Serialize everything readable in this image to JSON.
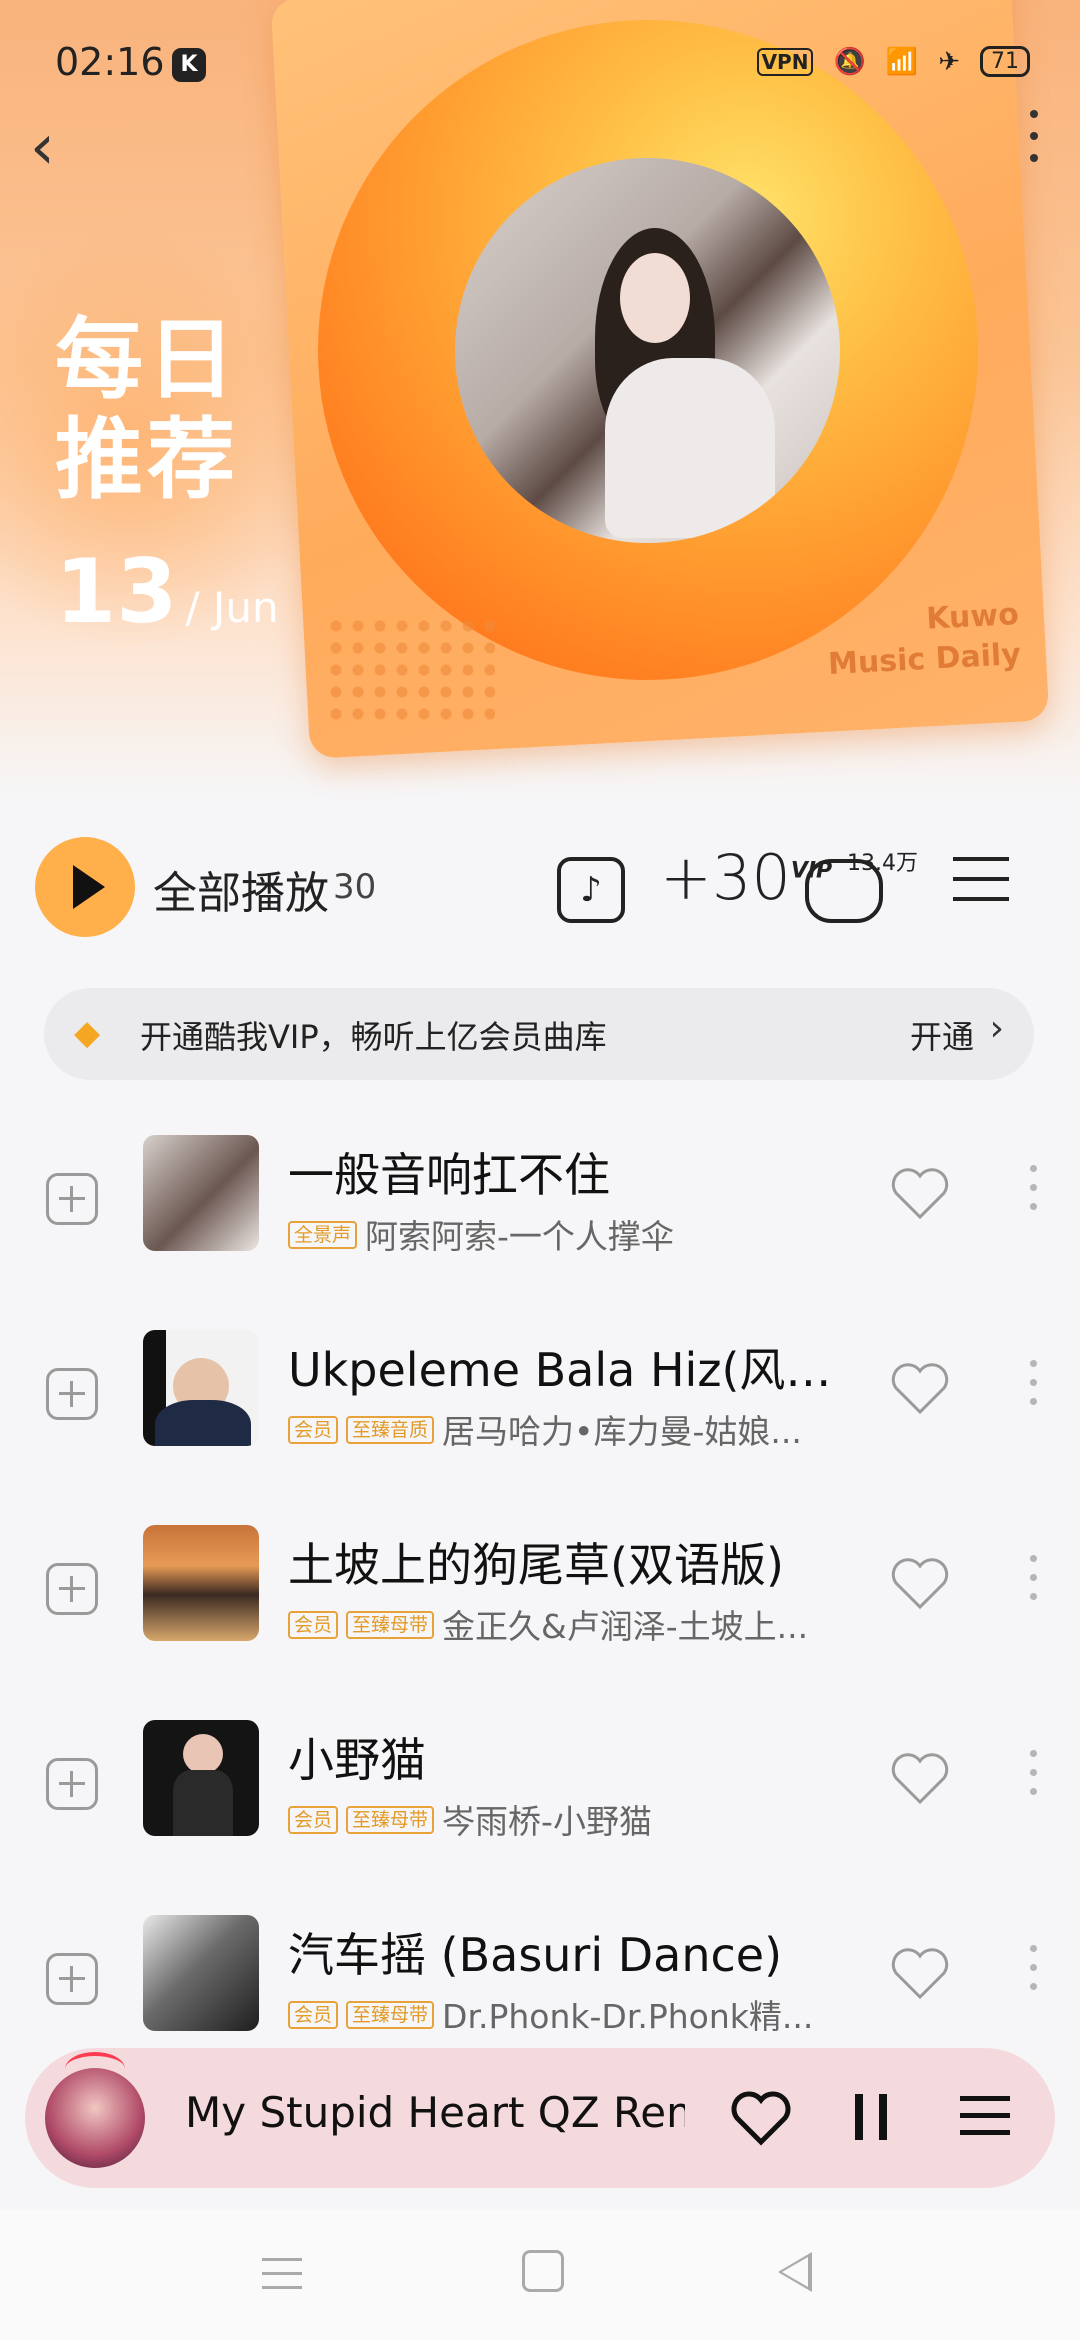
{
  "status_bar": {
    "time": "02:16",
    "app_icon": "K",
    "vpn": "VPN",
    "battery": "71"
  },
  "header": {
    "title_line1": "每日",
    "title_line2": "推荐",
    "day": "13",
    "month": "/ Jun",
    "brand_line1": "Kuwo",
    "brand_line2": "Music Daily"
  },
  "toolbar": {
    "play_all": "全部播放",
    "count": "30",
    "plus30": "+30",
    "vip_sup": "VIP",
    "comment_count": "13.4万"
  },
  "vip_banner": {
    "text": "开通酷我VIP，畅听上亿会员曲库",
    "action": "开通"
  },
  "songs": [
    {
      "title": "一般音响扛不住",
      "tags": [
        "全景声"
      ],
      "subtitle": "阿索阿索-一个人撑伞"
    },
    {
      "title": "Ukpeleme Bala Hiz(风情...",
      "tags": [
        "会员",
        "至臻音质"
      ],
      "subtitle": "居马哈力•库力曼-姑娘..."
    },
    {
      "title": "土坡上的狗尾草(双语版)",
      "tags": [
        "会员",
        "至臻母带"
      ],
      "subtitle": "金正久&卢润泽-土坡上..."
    },
    {
      "title": "小野猫",
      "tags": [
        "会员",
        "至臻母带"
      ],
      "subtitle": "岑雨桥-小野猫"
    },
    {
      "title": "汽车摇 (Basuri Dance)",
      "tags": [
        "会员",
        "至臻母带"
      ],
      "subtitle": "Dr.Phonk-Dr.Phonk精..."
    }
  ],
  "player": {
    "title": "My Stupid Heart QZ Remi"
  },
  "colors": {
    "accent": "#ffb04a",
    "tag": "#e8a23a",
    "player_bg": "#f4dadd"
  }
}
